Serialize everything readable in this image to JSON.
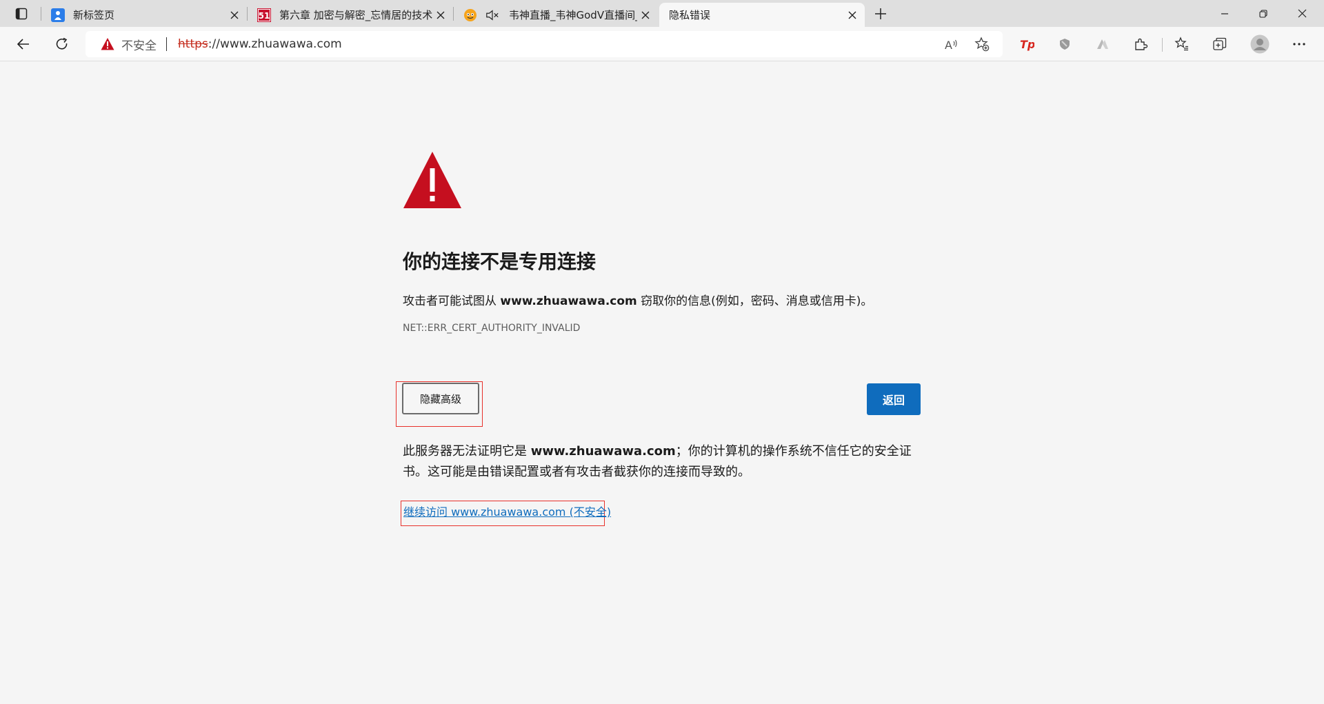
{
  "tabs": [
    {
      "title": "新标签页",
      "active": false
    },
    {
      "title": "第六章 加密与解密_忘情居的技术",
      "active": false
    },
    {
      "title": "韦神直播_韦神GodV直播间_",
      "active": false,
      "muted": true
    },
    {
      "title": "隐私错误",
      "active": true
    }
  ],
  "address": {
    "insecure_label": "不安全",
    "scheme": "https",
    "rest": "://www.zhuawawa.com"
  },
  "page": {
    "heading": "你的连接不是专用连接",
    "attack_pre": "攻击者可能试图从 ",
    "attack_domain": "www.zhuawawa.com",
    "attack_post": " 窃取你的信息(例如，密码、消息或信用卡)。",
    "error_code": "NET::ERR_CERT_AUTHORITY_INVALID",
    "hide_advanced_label": "隐藏高级",
    "back_label": "返回",
    "detail_pre": "此服务器无法证明它是 ",
    "detail_domain": "www.zhuawawa.com",
    "detail_post": "；你的计算机的操作系统不信任它的安全证书。这可能是由错误配置或者有攻击者截获你的连接而导致的。",
    "proceed_link": "继续访问 www.zhuawawa.com (不安全)"
  },
  "colors": {
    "warning_red": "#c50f1f",
    "primary_button": "#0f6cbd",
    "highlight_box": "#e8302a",
    "link": "#0f6cbd"
  },
  "icons": [
    "tab-actions-icon",
    "new-tab-favicon",
    "site-51-favicon",
    "site-live-favicon",
    "muted-speaker-icon",
    "close-icon",
    "plus-icon",
    "minimize-icon",
    "restore-icon",
    "back-arrow-icon",
    "refresh-icon",
    "warning-triangle-icon",
    "read-aloud-icon",
    "add-favorite-icon",
    "tp-extension-icon",
    "shield-extension-icon",
    "mountain-extension-icon",
    "extensions-puzzle-icon",
    "favorites-icon",
    "collections-icon",
    "profile-avatar-icon",
    "more-dots-icon"
  ]
}
